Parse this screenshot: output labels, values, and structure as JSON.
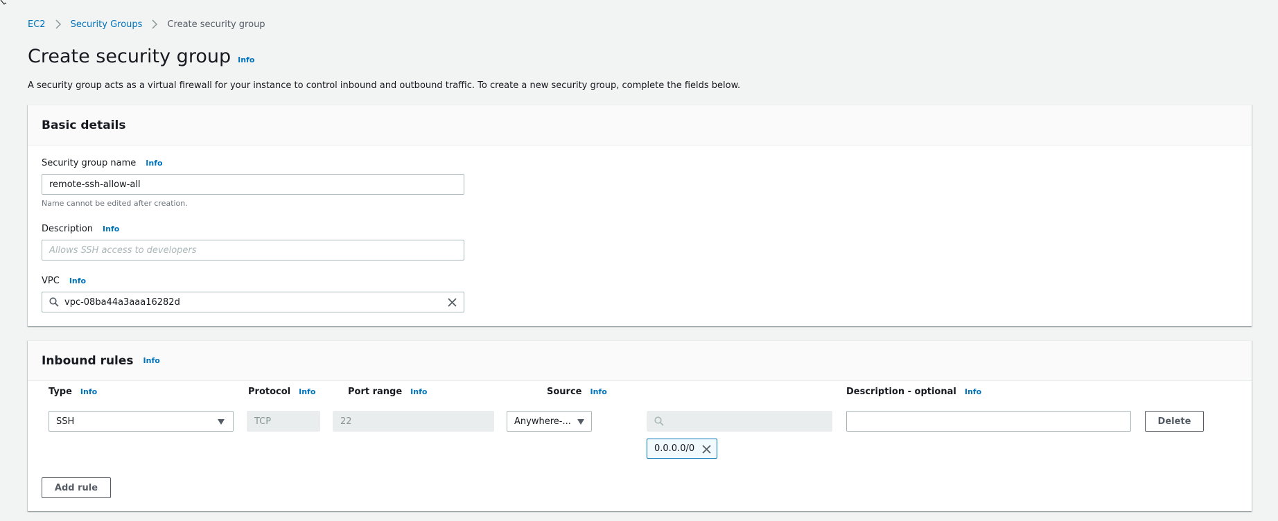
{
  "breadcrumb": {
    "items": [
      {
        "label": "EC2"
      },
      {
        "label": "Security Groups"
      },
      {
        "label": "Create security group"
      }
    ]
  },
  "header": {
    "title": "Create security group",
    "info_label": "Info",
    "description": "A security group acts as a virtual firewall for your instance to control inbound and outbound traffic. To create a new security group, complete the fields below."
  },
  "basic_details": {
    "title": "Basic details",
    "name": {
      "label": "Security group name",
      "info_label": "Info",
      "value": "remote-ssh-allow-all",
      "hint": "Name cannot be edited after creation."
    },
    "description": {
      "label": "Description",
      "info_label": "Info",
      "value": "",
      "placeholder": "Allows SSH access to developers"
    },
    "vpc": {
      "label": "VPC",
      "info_label": "Info",
      "value": "vpc-08ba44a3aaa16282d"
    }
  },
  "inbound_rules": {
    "title": "Inbound rules",
    "info_label": "Info",
    "columns": [
      {
        "label": "Type",
        "info_label": "Info"
      },
      {
        "label": "Protocol",
        "info_label": "Info"
      },
      {
        "label": "Port range",
        "info_label": "Info"
      },
      {
        "label": "Source",
        "info_label": "Info"
      },
      {
        "label": "Description - optional",
        "info_label": "Info"
      }
    ],
    "rules": [
      {
        "type": "SSH",
        "protocol": "TCP",
        "port_range": "22",
        "source_type": "Anywhere-...",
        "source_search": "",
        "source_tokens": [
          "0.0.0.0/0"
        ],
        "description": "",
        "delete_label": "Delete"
      }
    ],
    "add_rule_label": "Add rule"
  },
  "colors": {
    "link": "#0073bb",
    "background": "#f2f3f3",
    "panel_header": "#fafafa",
    "token_border": "#0073bb",
    "token_bg": "#f1faff"
  }
}
